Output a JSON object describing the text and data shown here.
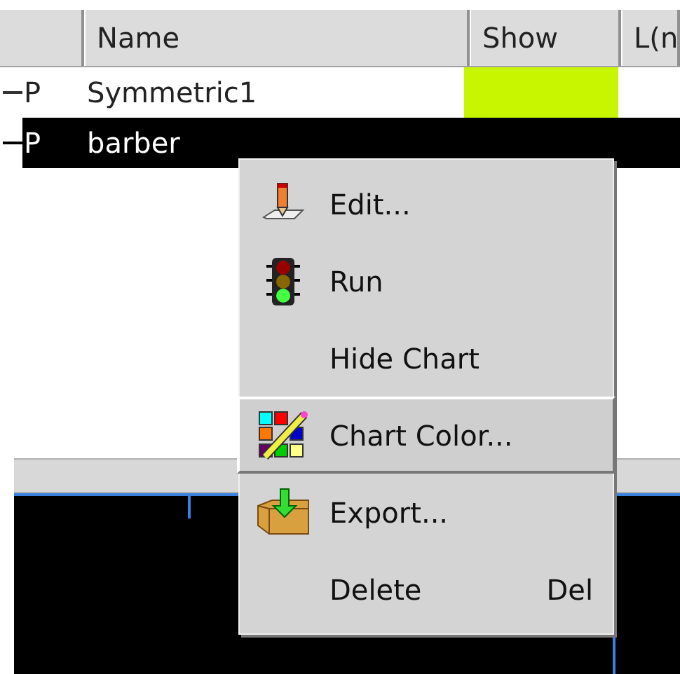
{
  "table": {
    "columns": [
      "Name",
      "Show",
      "L(n"
    ],
    "rows": [
      {
        "type_letter": "P",
        "name": "Symmetric1",
        "selected": false,
        "color": "#c8f500"
      },
      {
        "type_letter": "P",
        "name": "barber",
        "selected": true
      }
    ]
  },
  "context_menu": {
    "items": [
      {
        "label": "Edit...",
        "selected": false
      },
      {
        "label": "Run",
        "selected": false
      },
      {
        "label": "Hide Chart",
        "selected": false
      },
      {
        "label": "Chart Color...",
        "selected": true
      },
      {
        "label": "Export...",
        "selected": false
      },
      {
        "label": "Delete",
        "shortcut": "Del",
        "selected": false
      }
    ]
  }
}
